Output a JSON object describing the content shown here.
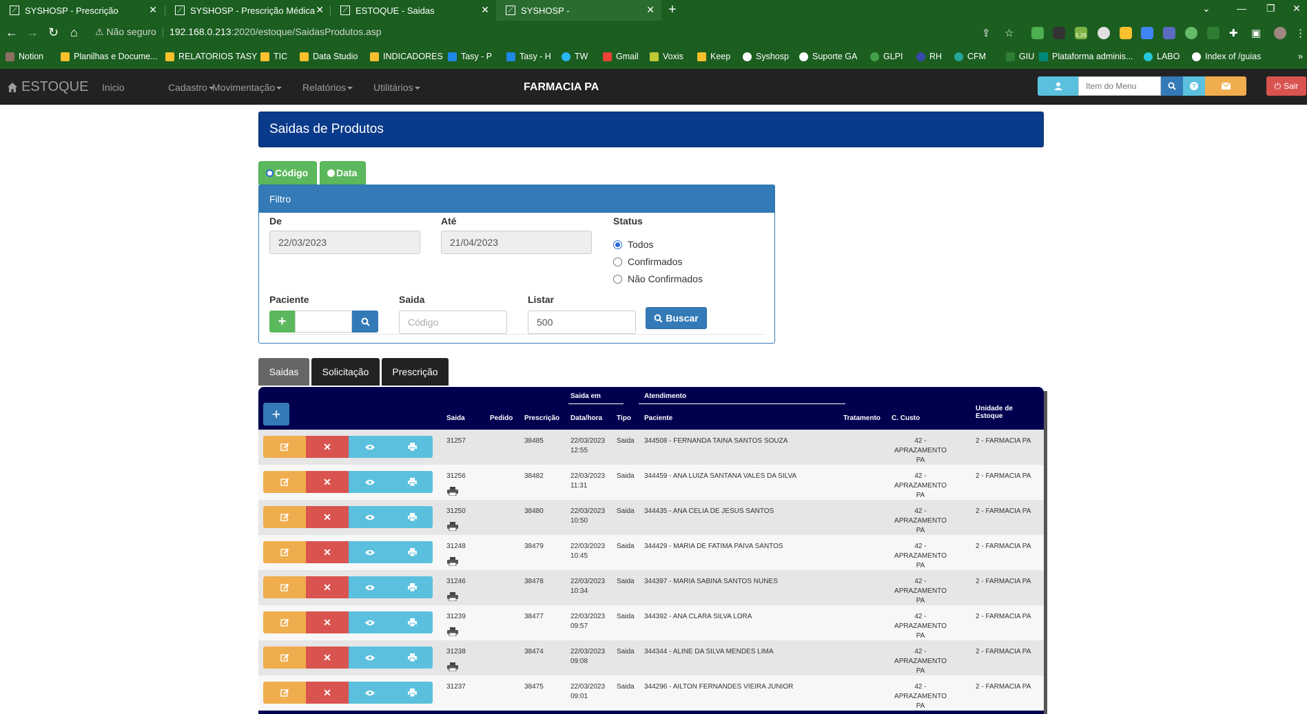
{
  "browser": {
    "tabs": [
      {
        "title": "SYSHOSP - Prescrição"
      },
      {
        "title": "SYSHOSP - Prescrição Médica"
      },
      {
        "title": "ESTOQUE - Saidas"
      },
      {
        "title": "SYSHOSP -"
      }
    ],
    "url_warning": "Não seguro",
    "url_host": "192.168.0.213",
    "url_path": ":2020/estoque/SaidasProdutos.asp",
    "extension_badge": "5,26",
    "bookmarks": [
      "Notion",
      "Planilhas e Docume...",
      "RELATORIOS TASY",
      "TIC",
      "Data Studio",
      "INDICADORES",
      "Tasy - P",
      "Tasy - H",
      "TW",
      "Gmail",
      "Voxis",
      "Keep",
      "Syshosp",
      "Suporte GA",
      "GLPI",
      "RH",
      "CFM",
      "GIU",
      "Plataforma adminis...",
      "LABO",
      "Index of /guias"
    ]
  },
  "navbar": {
    "brand": "ESTOQUE",
    "links": [
      "Inicio",
      "Cadastro",
      "Movimentação",
      "Relatórios",
      "Utilitários"
    ],
    "center_title": "FARMACIA PA",
    "menu_search_placeholder": "Item do Menu",
    "logout_label": "Sair"
  },
  "page": {
    "title": "Saidas de Produtos",
    "mode_codigo": "Código",
    "mode_data": "Data"
  },
  "filter": {
    "heading": "Filtro",
    "de_label": "De",
    "de_value": "22/03/2023",
    "ate_label": "Até",
    "ate_value": "21/04/2023",
    "status_label": "Status",
    "status_options": [
      "Todos",
      "Confirmados",
      "Não Confirmados"
    ],
    "status_selected": "Todos",
    "paciente_label": "Paciente",
    "saida_label": "Saida",
    "saida_placeholder": "Código",
    "listar_label": "Listar",
    "listar_value": "500",
    "buscar_label": "Buscar"
  },
  "subtabs": [
    "Saidas",
    "Solicitação",
    "Prescrição"
  ],
  "table": {
    "group_saida_em": "Saida em",
    "group_atendimento": "Atendimento",
    "headers": {
      "saida": "Saida",
      "pedido": "Pedido",
      "prescricao": "Prescrição",
      "datahora": "Data/hora",
      "tipo": "Tipo",
      "paciente": "Paciente",
      "tratamento": "Tratamento",
      "ccusto": "C. Custo",
      "unidade_1": "Unidade de",
      "unidade_2": "Estoque"
    },
    "rows": [
      {
        "saida": "31257",
        "pedido": "",
        "prescricao": "38485",
        "date": "22/03/2023",
        "time": "12:55",
        "tipo": "Saida",
        "paciente": "344508 - FERNANDA TAINA SANTOS SOUZA",
        "tratamento": "",
        "ccusto_1": "42 - APRAZAMENTO",
        "ccusto_2": "PA",
        "unidade": "2 - FARMACIA PA",
        "printed": false
      },
      {
        "saida": "31256",
        "pedido": "",
        "prescricao": "38482",
        "date": "22/03/2023",
        "time": "11:31",
        "tipo": "Saida",
        "paciente": "344459 - ANA LUIZA SANTANA VALES DA SILVA",
        "tratamento": "",
        "ccusto_1": "42 - APRAZAMENTO",
        "ccusto_2": "PA",
        "unidade": "2 - FARMACIA PA",
        "printed": true
      },
      {
        "saida": "31250",
        "pedido": "",
        "prescricao": "38480",
        "date": "22/03/2023",
        "time": "10:50",
        "tipo": "Saida",
        "paciente": "344435 - ANA CELIA DE JESUS SANTOS",
        "tratamento": "",
        "ccusto_1": "42 - APRAZAMENTO",
        "ccusto_2": "PA",
        "unidade": "2 - FARMACIA PA",
        "printed": true
      },
      {
        "saida": "31248",
        "pedido": "",
        "prescricao": "38479",
        "date": "22/03/2023",
        "time": "10:45",
        "tipo": "Saida",
        "paciente": "344429 - MARIA DE FATIMA PAIVA SANTOS",
        "tratamento": "",
        "ccusto_1": "42 - APRAZAMENTO",
        "ccusto_2": "PA",
        "unidade": "2 - FARMACIA PA",
        "printed": true
      },
      {
        "saida": "31246",
        "pedido": "",
        "prescricao": "38478",
        "date": "22/03/2023",
        "time": "10:34",
        "tipo": "Saida",
        "paciente": "344397 - MARIA SABINA SANTOS NUNES",
        "tratamento": "",
        "ccusto_1": "42 - APRAZAMENTO",
        "ccusto_2": "PA",
        "unidade": "2 - FARMACIA PA",
        "printed": true
      },
      {
        "saida": "31239",
        "pedido": "",
        "prescricao": "38477",
        "date": "22/03/2023",
        "time": "09:57",
        "tipo": "Saida",
        "paciente": "344392 - ANA CLARA SILVA LORA",
        "tratamento": "",
        "ccusto_1": "42 - APRAZAMENTO",
        "ccusto_2": "PA",
        "unidade": "2 - FARMACIA PA",
        "printed": true
      },
      {
        "saida": "31238",
        "pedido": "",
        "prescricao": "38474",
        "date": "22/03/2023",
        "time": "09:08",
        "tipo": "Saida",
        "paciente": "344344 - ALINE DA SILVA MENDES LIMA",
        "tratamento": "",
        "ccusto_1": "42 - APRAZAMENTO",
        "ccusto_2": "PA",
        "unidade": "2 - FARMACIA PA",
        "printed": true
      },
      {
        "saida": "31237",
        "pedido": "",
        "prescricao": "38475",
        "date": "22/03/2023",
        "time": "09:01",
        "tipo": "Saida",
        "paciente": "344296 - AILTON FERNANDES VIEIRA JUNIOR",
        "tratamento": "",
        "ccusto_1": "42 - APRAZAMENTO",
        "ccusto_2": "PA",
        "unidade": "2 - FARMACIA PA",
        "printed": false
      }
    ]
  },
  "colors": {
    "browser_green": "#1b5e20",
    "navbar_dark": "#222222",
    "header_blue": "#0a3a8a",
    "grid_navy": "#00004f",
    "btn_edit": "#f0ad4e",
    "btn_delete": "#d9534f",
    "btn_view": "#5bc0de",
    "btn_success": "#5cb85c",
    "btn_primary": "#337ab7"
  }
}
